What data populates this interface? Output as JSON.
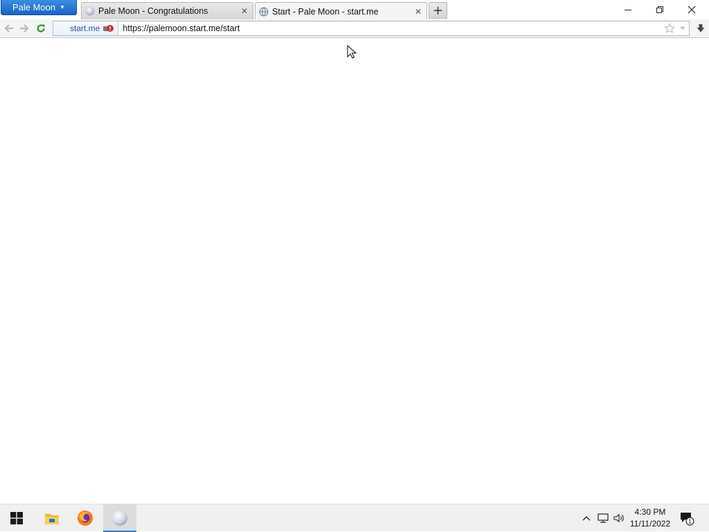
{
  "browser": {
    "app_menu_label": "Pale Moon",
    "tabs": [
      {
        "title": "Pale Moon - Congratulations",
        "icon": "moon-icon",
        "active": false
      },
      {
        "title": "Start - Pale Moon - start.me",
        "icon": "globe-icon",
        "active": true
      }
    ],
    "new_tab_label": "+",
    "window_controls": {
      "minimize": "—",
      "restore": "❐",
      "close": "✕"
    }
  },
  "navbar": {
    "back_icon": "back-arrow-icon",
    "forward_icon": "forward-arrow-icon",
    "reload_icon": "reload-icon",
    "identity_label": "start.me",
    "url": "https://palemoon.start.me/start",
    "bookmark_icon": "star-icon",
    "dropdown_icon": "chevron-down-icon",
    "download_icon": "download-arrow-icon"
  },
  "taskbar": {
    "apps": [
      {
        "name": "start-icon"
      },
      {
        "name": "file-explorer-icon"
      },
      {
        "name": "firefox-icon"
      },
      {
        "name": "pale-moon-icon",
        "active": true
      }
    ],
    "tray": {
      "time": "4:30 PM",
      "date": "11/11/2022",
      "notification_count": "1"
    }
  },
  "colors": {
    "accent": "#1a62c8",
    "taskbar_active_indicator": "#2a7ad6",
    "reload_green": "#2c9a3c"
  }
}
